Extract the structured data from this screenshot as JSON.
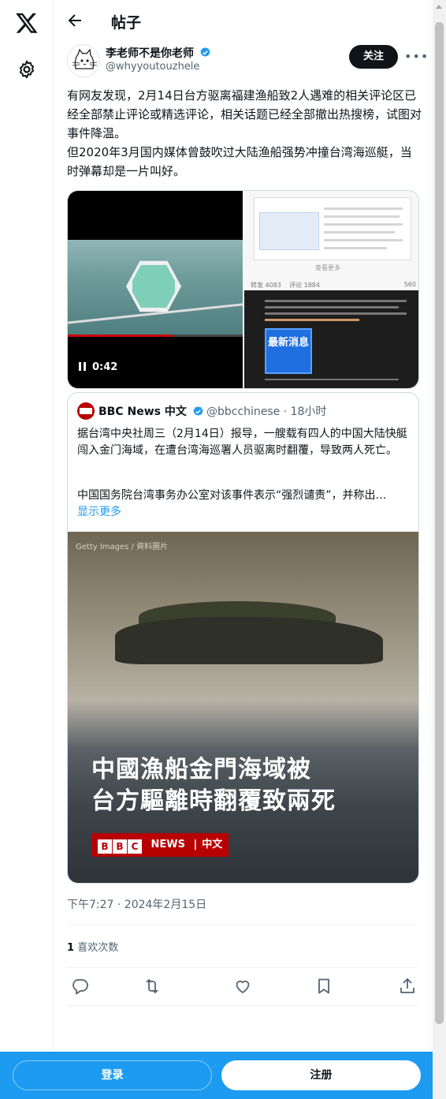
{
  "nav": {
    "x_logo": "x-logo-icon",
    "settings": "gear-icon"
  },
  "header": {
    "title": "帖子"
  },
  "author": {
    "name": "李老师不是你老师",
    "handle": "@whyyoutouzhele",
    "follow_label": "关注",
    "more_label": "•••"
  },
  "tweet": {
    "paragraph1": "有网友发现，2月14日台方驱离福建渔船致2人遇难的相关评论区已经全部禁止评论或精选评论，相关话题已经全部撤出热搜榜，试图对事件降温。",
    "paragraph2": "但2020年3月国内媒体曾鼓吹过大陆渔船强势冲撞台湾海巡艇，当时弹幕却是一片叫好。"
  },
  "media": {
    "video_duration": "0:42",
    "img2_more": "查看更多",
    "img2_stats": [
      "转发 4083",
      "评论 1884",
      "560"
    ],
    "img3_badge": "最新消息"
  },
  "quote": {
    "name": "BBC News 中文",
    "handle": "@bbcchinese · 18小时",
    "text1": "据台湾中央社周三（2月14日）报导，一艘载有四人的中国大陆快艇闯入金门海域，在遭台湾海巡署人员驱离时翻覆，导致两人死亡。",
    "text2": "中国国务院台湾事务办公室对该事件表示“强烈谴责”，并称出…",
    "show_more": "显示更多",
    "photo_credit": "Getty Images / 資料圖片",
    "headline_line1": "中國漁船金門海域被",
    "headline_line2": "台方驅離時翻覆致兩死",
    "brand_letters": [
      "B",
      "B",
      "C"
    ],
    "brand_news": "NEWS",
    "brand_lang": "中文"
  },
  "meta": {
    "timestamp": "下午7:27 · 2024年2月15日",
    "likes_count": "1",
    "likes_label": "喜欢次数"
  },
  "actions": [
    "reply-icon",
    "retweet-icon",
    "like-icon",
    "bookmark-icon",
    "share-icon"
  ],
  "bottom": {
    "login": "登录",
    "signup": "注册"
  },
  "colors": {
    "brand_blue": "#1d9bf0",
    "bbc_red": "#b80000",
    "text": "#0f1419",
    "muted": "#536471"
  }
}
